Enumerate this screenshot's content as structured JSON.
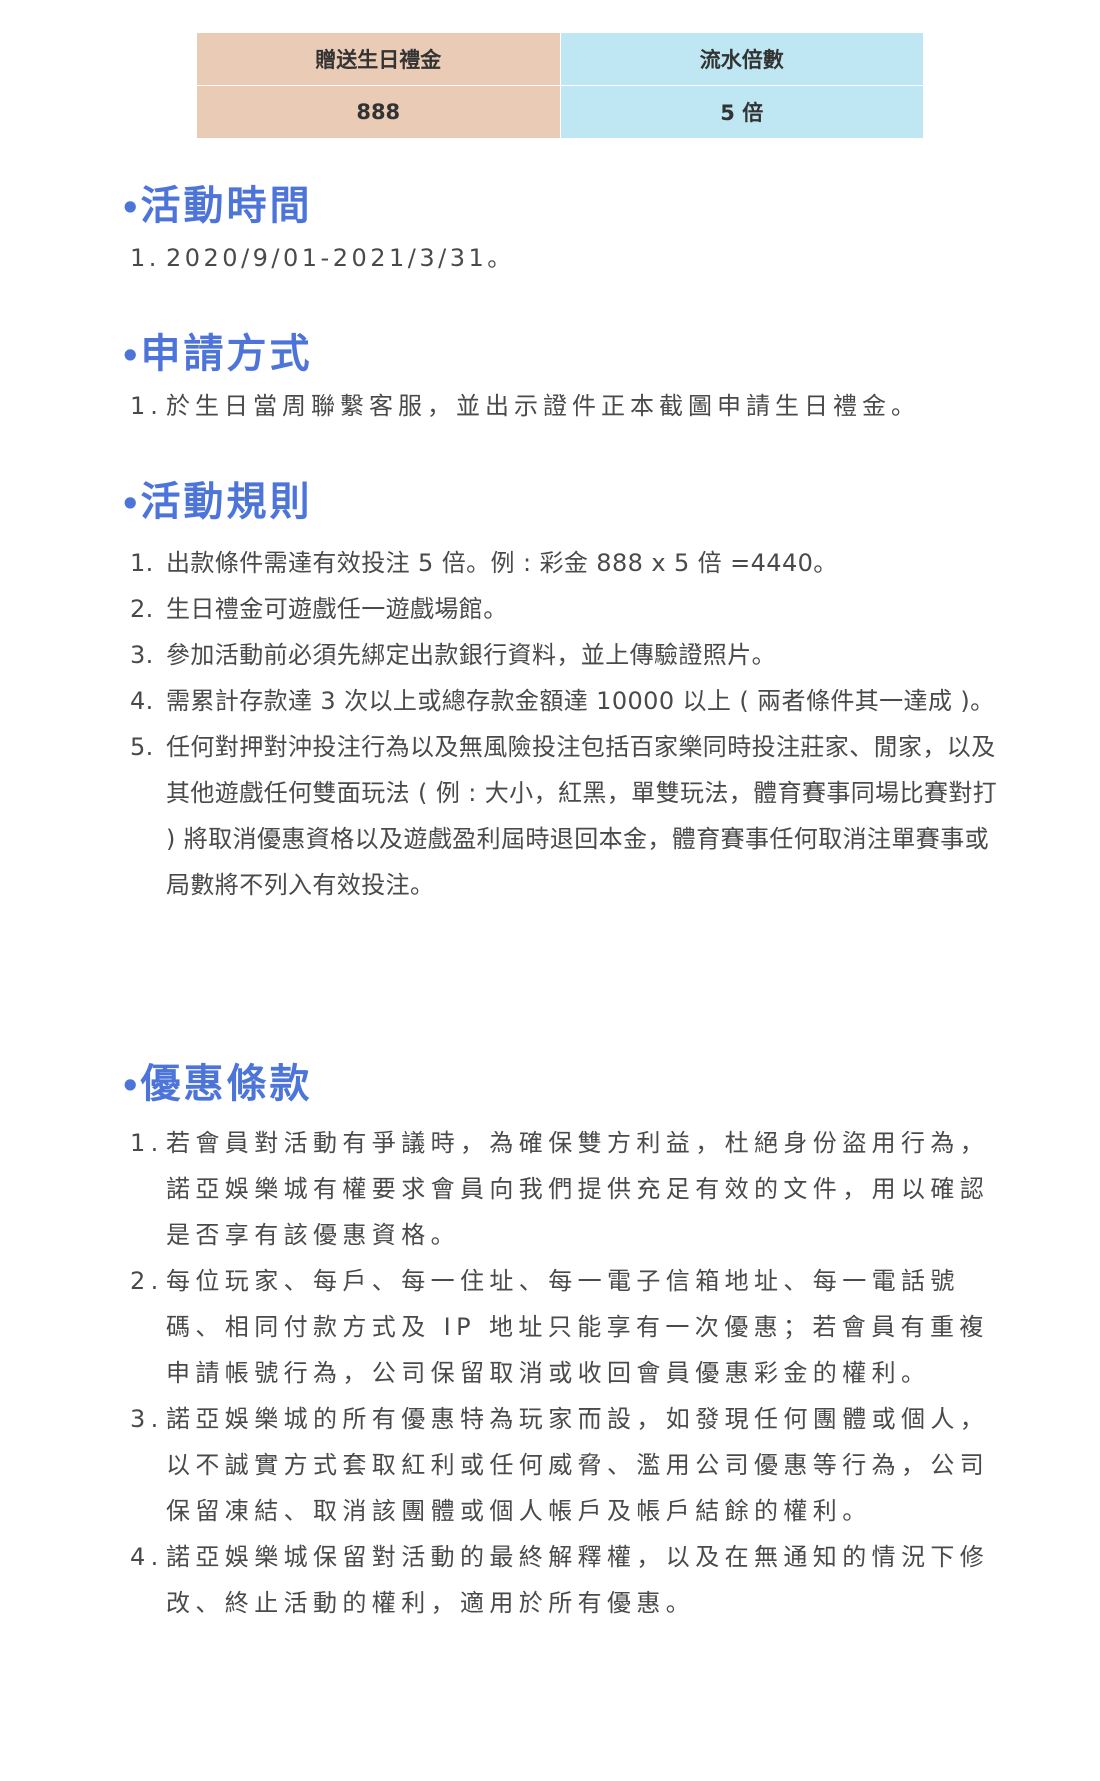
{
  "table": {
    "headers": [
      "贈送生日禮金",
      "流水倍數"
    ],
    "row": [
      "888",
      "5 倍"
    ]
  },
  "sections": [
    {
      "title": "活動時間",
      "items": [
        {
          "num": "1.",
          "text": "2020/9/01-2021/3/31。"
        }
      ]
    },
    {
      "title": "申請方式",
      "items": [
        {
          "num": "1.",
          "text": "於生日當周聯繫客服，並出示證件正本截圖申請生日禮金。"
        }
      ]
    },
    {
      "title": "活動規則",
      "items": [
        {
          "num": "1.",
          "text": "出款條件需達有效投注 5 倍。例 : 彩金 888 x 5 倍 =4440。"
        },
        {
          "num": "2.",
          "text": "生日禮金可遊戲任一遊戲場館。"
        },
        {
          "num": "3.",
          "text": "參加活動前必須先綁定出款銀行資料，並上傳驗證照片。"
        },
        {
          "num": "4.",
          "text": "需累計存款達 3 次以上或總存款金額達 10000 以上 ( 兩者條件其一達成 )。"
        },
        {
          "num": "5.",
          "text": "任何對押對沖投注行為以及無風險投注包括百家樂同時投注莊家、閒家，以及其他遊戲任何雙面玩法 ( 例 : 大小，紅黑，單雙玩法，體育賽事同場比賽對打 ) 將取消優惠資格以及遊戲盈利屆時退回本金，體育賽事任何取消注單賽事或局數將不列入有效投注。"
        }
      ]
    },
    {
      "title": "優惠條款",
      "items": [
        {
          "num": "1.",
          "text": "若會員對活動有爭議時，為確保雙方利益，杜絕身份盜用行為，諾亞娛樂城有權要求會員向我們提供充足有效的文件，用以確認是否享有該優惠資格。"
        },
        {
          "num": "2.",
          "text": "每位玩家、每戶、每一住址、每一電子信箱地址、每一電話號碼、相同付款方式及 IP 地址只能享有一次優惠；若會員有重複申請帳號行為，公司保留取消或收回會員優惠彩金的權利。"
        },
        {
          "num": "3.",
          "text": "諾亞娛樂城的所有優惠特為玩家而設，如發現任何團體或個人，以不誠實方式套取紅利或任何威脅、濫用公司優惠等行為，公司保留凍結、取消該團體或個人帳戶及帳戶結餘的權利。"
        },
        {
          "num": "4.",
          "text": "諾亞娛樂城保留對活動的最終解釋權，以及在無通知的情況下修改、終止活動的權利，適用於所有優惠。"
        }
      ]
    }
  ],
  "colors": {
    "title": "#4d74d8",
    "table_left": "#eaccb6",
    "table_right": "#bfe7f3",
    "body_text": "#4a4a4a"
  }
}
